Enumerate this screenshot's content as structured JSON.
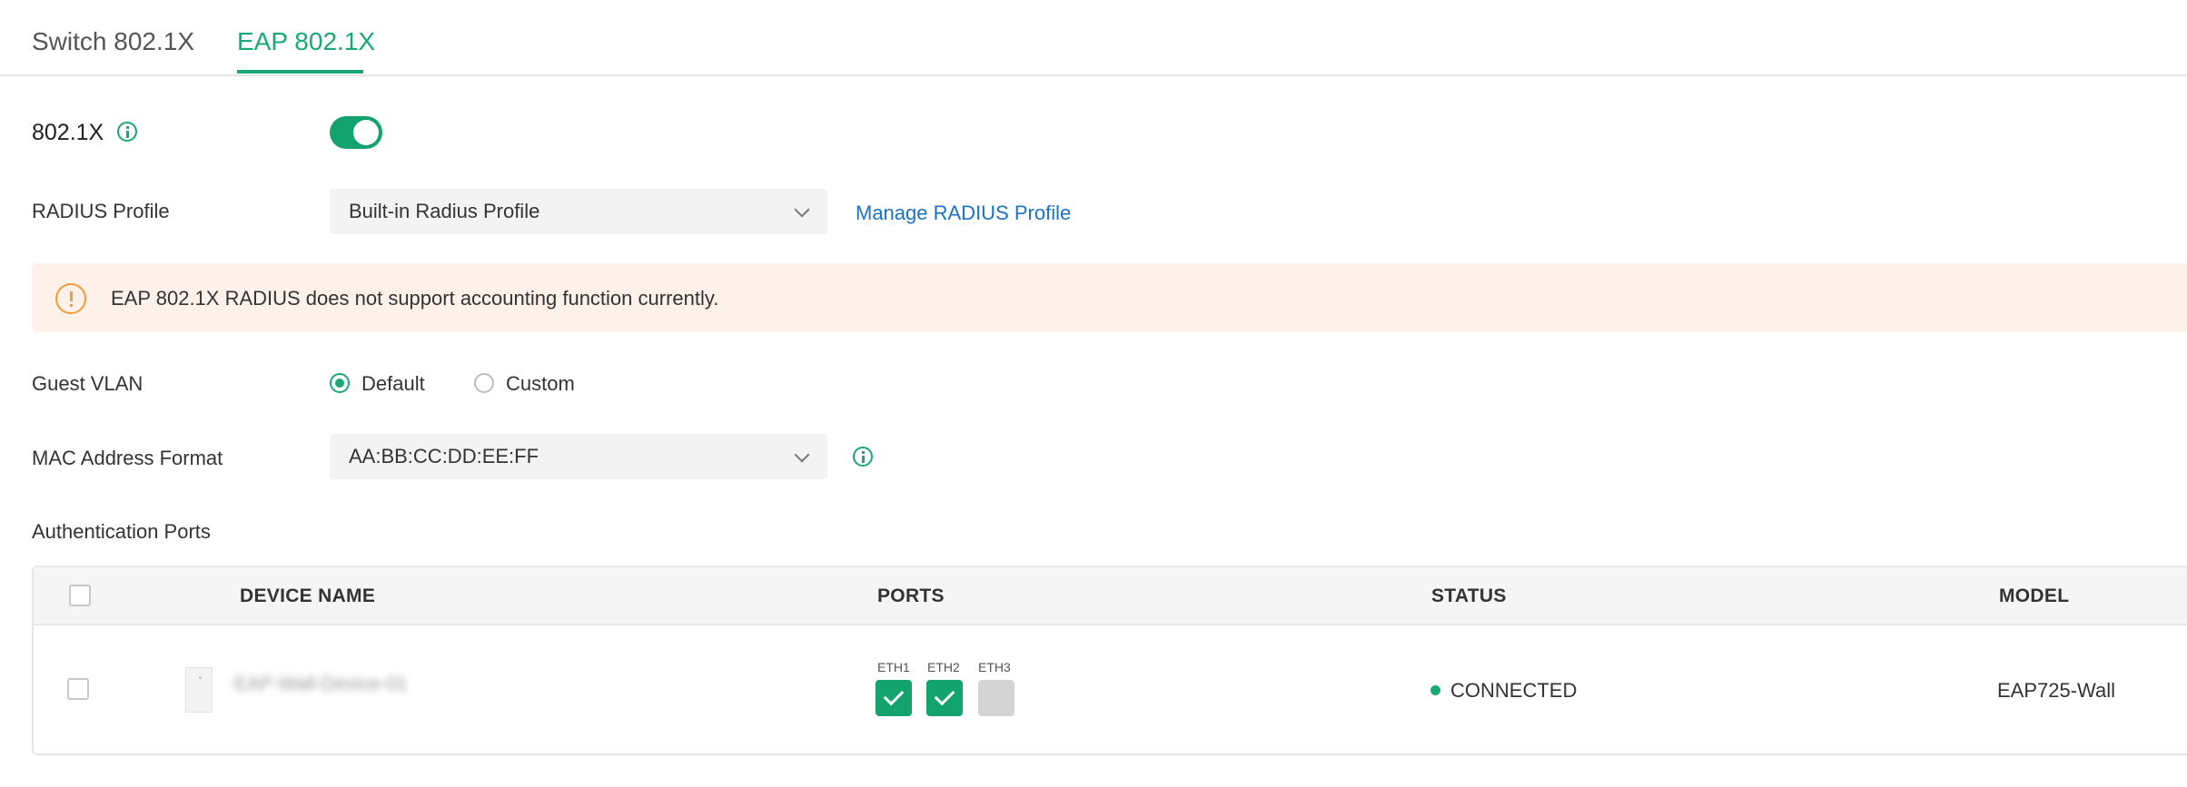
{
  "tabs": [
    {
      "label": "Switch 802.1X",
      "active": false
    },
    {
      "label": "EAP 802.1X",
      "active": true
    }
  ],
  "dot1x": {
    "label": "802.1X",
    "enabled": true
  },
  "radius_profile": {
    "label": "RADIUS Profile",
    "selected": "Built-in Radius Profile",
    "manage_link": "Manage RADIUS Profile"
  },
  "alert": {
    "text": "EAP 802.1X RADIUS does not support accounting function currently."
  },
  "guest_vlan": {
    "label": "Guest VLAN",
    "options": [
      {
        "label": "Default",
        "selected": true
      },
      {
        "label": "Custom",
        "selected": false
      }
    ]
  },
  "mac_format": {
    "label": "MAC Address Format",
    "selected": "AA:BB:CC:DD:EE:FF"
  },
  "auth_ports": {
    "title": "Authentication Ports",
    "columns": [
      "DEVICE NAME",
      "PORTS",
      "STATUS",
      "MODEL"
    ],
    "rows": [
      {
        "device_name": "EAP-Wall-Device-01",
        "ports": [
          {
            "name": "ETH1",
            "selected": true
          },
          {
            "name": "ETH2",
            "selected": true
          },
          {
            "name": "ETH3",
            "selected": false
          }
        ],
        "status": "CONNECTED",
        "model": "EAP725-Wall"
      }
    ]
  },
  "colors": {
    "accent": "#19a974",
    "link": "#1a73c8",
    "alert_bg": "#fdf1e9",
    "warning": "#f29d38"
  }
}
